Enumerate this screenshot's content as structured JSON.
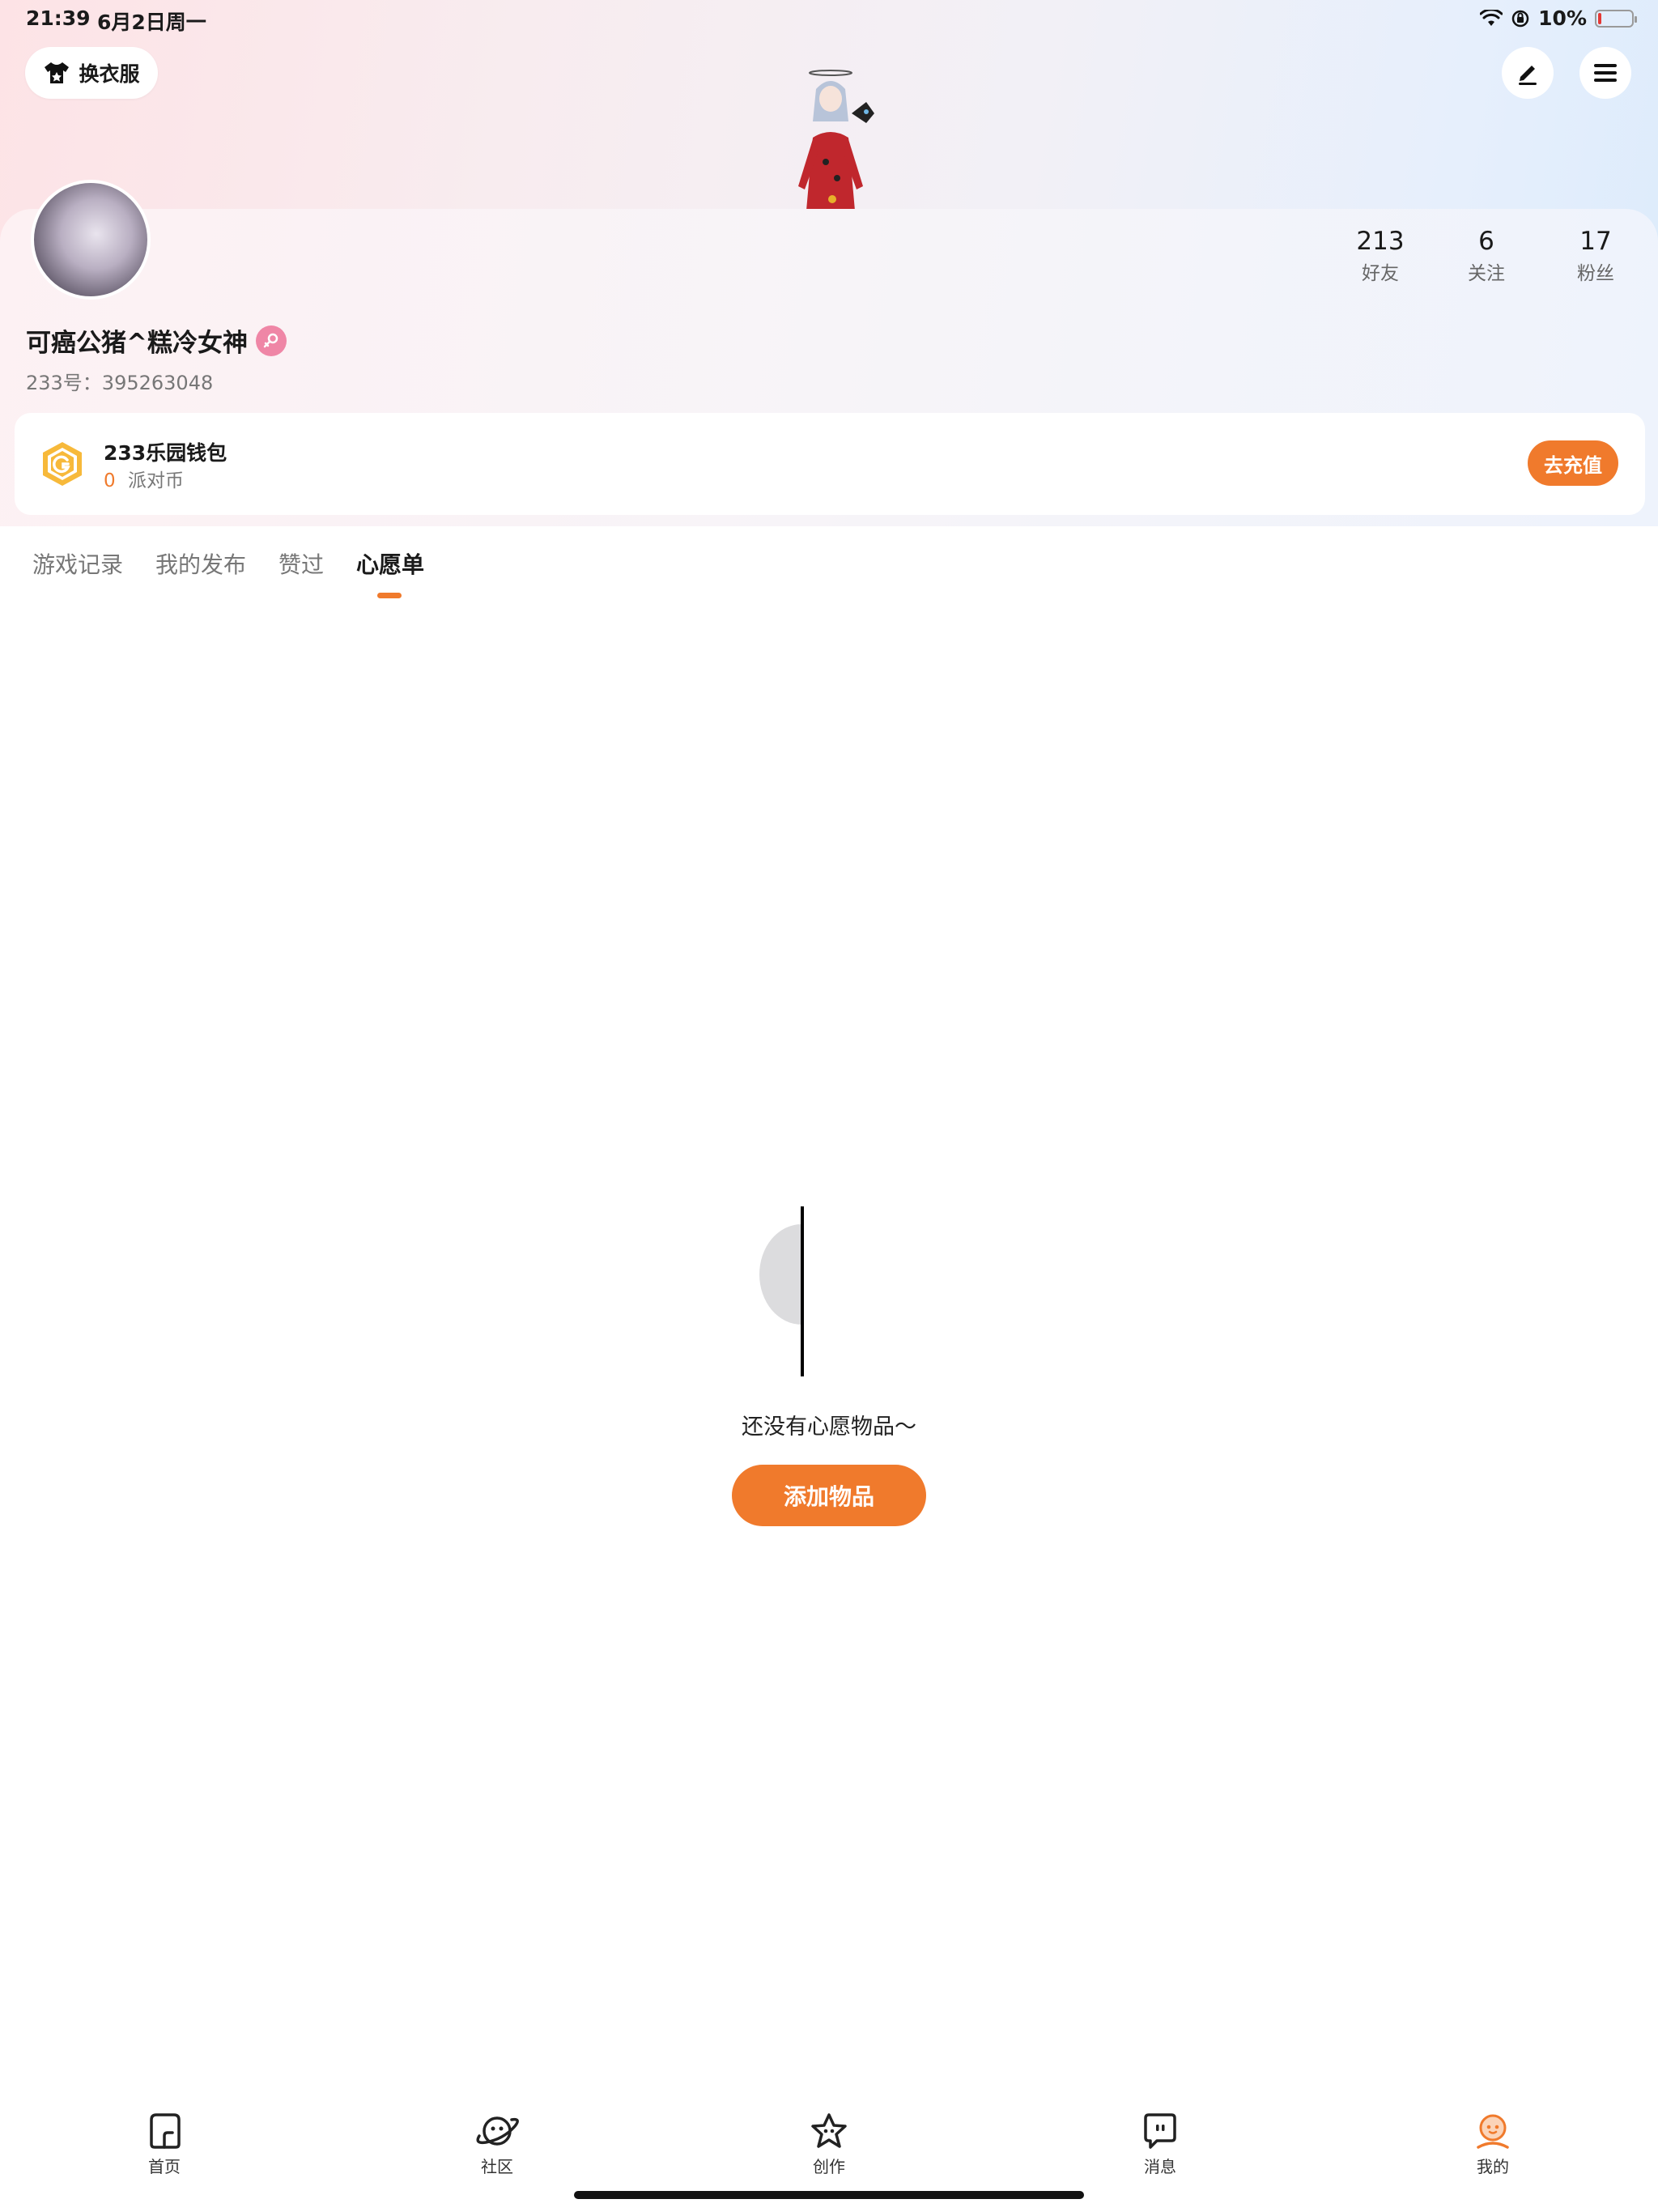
{
  "status_bar": {
    "time": "21:39",
    "date": "6月2日周一",
    "battery_text": "10%",
    "battery_level": 0.1,
    "battery_color": "#e53935"
  },
  "header": {
    "outfit_label": "换衣服",
    "outfit_icon": "shirt-icon",
    "edit_icon": "edit-icon",
    "menu_icon": "menu-icon"
  },
  "profile": {
    "username": "可癌公猪^糕冷女神",
    "gender_icon": "female-icon",
    "uid": "233号：395263048",
    "stats": [
      {
        "value": "213",
        "label": "好友"
      },
      {
        "value": "6",
        "label": "关注"
      },
      {
        "value": "17",
        "label": "粉丝"
      }
    ]
  },
  "wallet": {
    "title": "233乐园钱包",
    "balance": "0",
    "unit": "派对币",
    "action": "去充值",
    "icon": "coin-icon"
  },
  "tabs": [
    {
      "label": "游戏记录",
      "active": false
    },
    {
      "label": "我的发布",
      "active": false
    },
    {
      "label": "赞过",
      "active": false
    },
    {
      "label": "心愿单",
      "active": true
    }
  ],
  "empty_state": {
    "message": "还没有心愿物品～",
    "button": "添加物品"
  },
  "bottom_nav": [
    {
      "label": "首页",
      "icon": "home-icon"
    },
    {
      "label": "社区",
      "icon": "planet-icon"
    },
    {
      "label": "创作",
      "icon": "star-icon"
    },
    {
      "label": "消息",
      "icon": "message-icon"
    },
    {
      "label": "我的",
      "icon": "profile-icon",
      "active": true
    }
  ],
  "colors": {
    "accent": "#f07a2c",
    "gender_badge": "#ef86a6"
  }
}
